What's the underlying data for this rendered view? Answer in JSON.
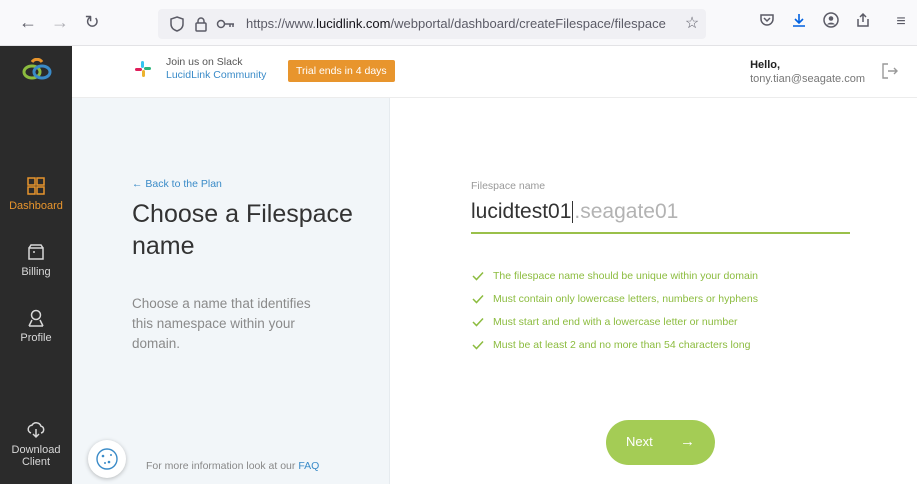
{
  "browser": {
    "url_prefix": "https://www.",
    "url_domain": "lucidlink.com",
    "url_path": "/webportal/dashboard/createFilespace/filespacenam"
  },
  "sidebar": {
    "items": [
      {
        "label": "Dashboard",
        "icon": "dashboard-icon",
        "active": true
      },
      {
        "label": "Billing",
        "icon": "billing-icon"
      },
      {
        "label": "Profile",
        "icon": "profile-icon"
      },
      {
        "label": "Download Client",
        "icon": "cloud-download-icon"
      }
    ]
  },
  "header": {
    "slack_line1": "Join us on Slack",
    "slack_line2": "LucidLink Community",
    "trial": "Trial ends in 4 days",
    "hello": "Hello,",
    "email": "tony.tian@seagate.com"
  },
  "left": {
    "back": "← Back to the Plan",
    "title": "Choose a Filespace name",
    "description": "Choose a name that identifies this namespace within your domain.",
    "footer_prefix": "For more information look at our ",
    "footer_link": "FAQ"
  },
  "form": {
    "label": "Filespace name",
    "value": "lucidtest01",
    "suffix": ".seagate01",
    "rules": [
      "The filespace name should be unique within your domain",
      "Must contain only lowercase letters, numbers or hyphens",
      "Must start and end with a lowercase letter or number",
      "Must be at least 2 and no more than 54 characters long"
    ],
    "next": "Next",
    "next_arrow": "→"
  },
  "colors": {
    "accent_green": "#a4cc55",
    "accent_orange": "#e8952d",
    "link_blue": "#3a8bc8"
  }
}
